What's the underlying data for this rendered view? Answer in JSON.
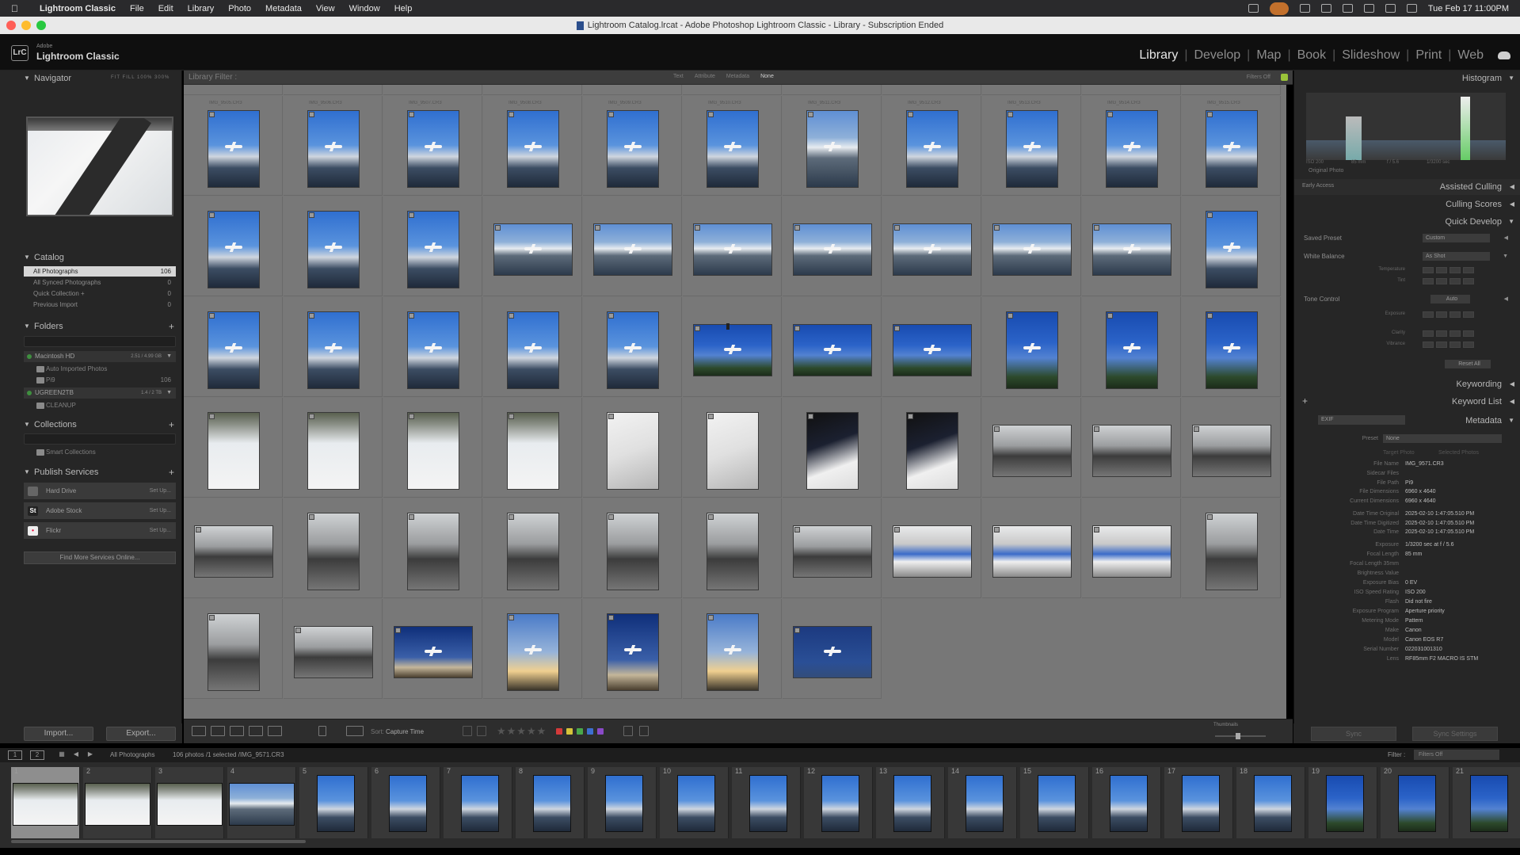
{
  "menubar": {
    "app": "Lightroom Classic",
    "items": [
      "File",
      "Edit",
      "Library",
      "Photo",
      "Metadata",
      "View",
      "Window",
      "Help"
    ],
    "clock": "Tue Feb 17  11:00PM"
  },
  "window": {
    "title": "Lightroom Catalog.lrcat - Adobe Photoshop Lightroom Classic - Library - Subscription Ended"
  },
  "identity": {
    "badge": "LrC",
    "small": "Adobe",
    "brand": "Lightroom Classic",
    "modules": [
      "Library",
      "Develop",
      "Map",
      "Book",
      "Slideshow",
      "Print",
      "Web"
    ],
    "active": "Library"
  },
  "left": {
    "navigator": {
      "title": "Navigator",
      "options": "FIT  FILL  100%  300%"
    },
    "catalog": {
      "title": "Catalog",
      "rows": [
        {
          "label": "All Photographs",
          "count": "106"
        },
        {
          "label": "All Synced Photographs",
          "count": "0"
        },
        {
          "label": "Quick Collection +",
          "count": "0"
        },
        {
          "label": "Previous Import",
          "count": "0"
        }
      ]
    },
    "folders": {
      "title": "Folders",
      "volumes": [
        {
          "label": "Macintosh HD",
          "size": "2.51 / 4.99 GB"
        },
        {
          "label": "UGREEN2TB",
          "size": "1.4 / 2 TB"
        }
      ],
      "subs": [
        {
          "label": "Auto Imported Photos",
          "count": ""
        },
        {
          "label": "Pi9",
          "count": "106"
        },
        {
          "label": "CLEANUP",
          "count": ""
        }
      ]
    },
    "collections": {
      "title": "Collections",
      "smart": "Smart Collections"
    },
    "publish": {
      "title": "Publish Services",
      "rows": [
        {
          "label": "Hard Drive",
          "setup": "Set Up..."
        },
        {
          "label": "Adobe Stock",
          "setup": "Set Up..."
        },
        {
          "label": "Flickr",
          "setup": "Set Up..."
        }
      ],
      "find_more": "Find More Services Online..."
    },
    "import_label": "Import...",
    "export_label": "Export..."
  },
  "filterbar": {
    "title": "Library Filter :",
    "tabs": [
      "Text",
      "Attribute",
      "Metadata",
      "None"
    ],
    "active": "None",
    "filters_off": "Filters Off"
  },
  "toolbar": {
    "sort_label": "Sort:",
    "sort_value": "Capture Time",
    "thumbs_label": "Thumbnails"
  },
  "right": {
    "histogram": {
      "title": "Histogram",
      "iso": "ISO 200",
      "focal": "85 mm",
      "aperture": "f / 5.6",
      "shutter": "1/3200 sec",
      "original": "Original Photo"
    },
    "panels": {
      "early": "Early Access",
      "assisted": "Assisted Culling",
      "culling": "Culling Scores",
      "quick": "Quick Develop",
      "keywording": "Keywording",
      "keywordlist": "Keyword List",
      "metadata": "Metadata"
    },
    "quick_develop": {
      "saved_preset": "Saved Preset",
      "saved_preset_val": "Custom",
      "white_balance": "White Balance",
      "white_balance_val": "As Shot",
      "temperature": "Temperature",
      "tint": "Tint",
      "tone": "Tone Control",
      "auto": "Auto",
      "exposure": "Exposure",
      "clarity": "Clarity",
      "vibrance": "Vibrance",
      "reset": "Reset All"
    },
    "metadata_preset": {
      "set": "EXIF",
      "preset_label": "Preset",
      "preset_val": "None",
      "target": "Target Photo",
      "selected": "Selected Photos"
    },
    "metadata_rows": [
      {
        "k": "File Name",
        "v": "IMG_9571.CR3"
      },
      {
        "k": "Sidecar Files",
        "v": ""
      },
      {
        "k": "File Path",
        "v": "Pi9"
      },
      {
        "k": "File Dimensions",
        "v": "6960 x 4640"
      },
      {
        "k": "Current Dimensions",
        "v": "6960 x 4640"
      },
      {
        "k": "Date Time Original",
        "v": "2025-02-10 1:47:05.510 PM"
      },
      {
        "k": "Date Time Digitized",
        "v": "2025-02-10 1:47:05.510 PM"
      },
      {
        "k": "Date Time",
        "v": "2025-02-10 1:47:05.510 PM"
      },
      {
        "k": "Exposure",
        "v": "1/3200 sec at f / 5.6"
      },
      {
        "k": "Focal Length",
        "v": "85 mm"
      },
      {
        "k": "Focal Length 35mm",
        "v": ""
      },
      {
        "k": "Brightness Value",
        "v": ""
      },
      {
        "k": "Exposure Bias",
        "v": "0 EV"
      },
      {
        "k": "ISO Speed Rating",
        "v": "ISO 200"
      },
      {
        "k": "Flash",
        "v": "Did not fire"
      },
      {
        "k": "Exposure Program",
        "v": "Aperture priority"
      },
      {
        "k": "Metering Mode",
        "v": "Pattern"
      },
      {
        "k": "Make",
        "v": "Canon"
      },
      {
        "k": "Model",
        "v": "Canon EOS R7"
      },
      {
        "k": "Serial Number",
        "v": "022031001310"
      },
      {
        "k": "Lens",
        "v": "RF85mm F2 MACRO IS STM"
      }
    ],
    "sync": "Sync",
    "sync_settings": "Sync Settings"
  },
  "filmstrip": {
    "source": "All Photographs",
    "info": "106 photos /1 selected /IMG_9571.CR3",
    "filter_label": "Filter :",
    "filter_val": "Filters Off",
    "numbers": [
      "1",
      "2",
      "3",
      "4",
      "5",
      "6",
      "7",
      "8",
      "9",
      "10",
      "11",
      "12",
      "13",
      "14",
      "15",
      "16",
      "17",
      "18",
      "19",
      "20",
      "21"
    ]
  },
  "grid": {
    "files": [
      "IMG_9505.CR3",
      "IMG_9506.CR3",
      "IMG_9507.CR3",
      "IMG_9508.CR3",
      "IMG_9509.CR3",
      "IMG_9510.CR3",
      "IMG_9511.CR3",
      "IMG_9512.CR3",
      "IMG_9513.CR3",
      "IMG_9514.CR3",
      "IMG_9515.CR3"
    ]
  }
}
